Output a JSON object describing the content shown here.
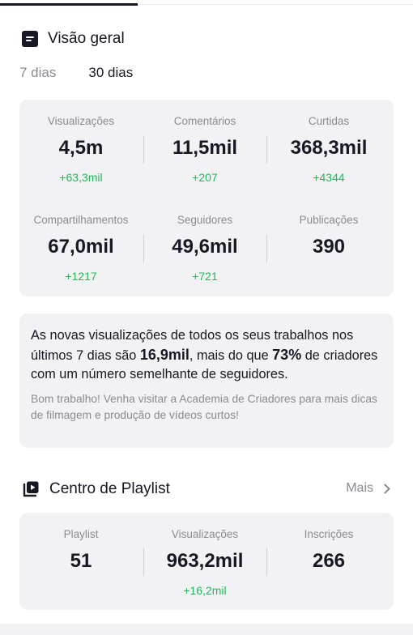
{
  "overview": {
    "title": "Visão geral",
    "icon": "overview-doc-icon",
    "tabs": [
      {
        "label": "7 dias",
        "active": false
      },
      {
        "label": "30 dias",
        "active": true
      }
    ],
    "metrics": [
      {
        "label": "Visualizações",
        "value": "4,5m",
        "delta": "+63,3mil"
      },
      {
        "label": "Comentários",
        "value": "11,5mil",
        "delta": "+207"
      },
      {
        "label": "Curtidas",
        "value": "368,3mil",
        "delta": "+4344"
      },
      {
        "label": "Compartilhamentos",
        "value": "67,0mil",
        "delta": "+1217"
      },
      {
        "label": "Seguidores",
        "value": "49,6mil",
        "delta": "+721"
      },
      {
        "label": "Publicações",
        "value": "390",
        "delta": ""
      }
    ]
  },
  "insight": {
    "text_part1": "As novas visualizações de todos os seus trabalhos nos últimos 7 dias são ",
    "highlight_views": "16,9mil",
    "text_part2": ", mais do que ",
    "highlight_percent": "73%",
    "text_part3": " de criadores com um número semelhante de seguidores.",
    "tip": "Bom trabalho! Venha visitar a Academia de Criadores para mais dicas de filmagem e produção de vídeos curtos!"
  },
  "playlist": {
    "title": "Centro de Playlist",
    "icon": "playlist-play-icon",
    "more_label": "Mais",
    "metrics": [
      {
        "label": "Playlist",
        "value": "51",
        "delta": ""
      },
      {
        "label": "Visualizações",
        "value": "963,2mil",
        "delta": "+16,2mil"
      },
      {
        "label": "Inscrições",
        "value": "266",
        "delta": ""
      }
    ]
  },
  "colors": {
    "positive": "#20b858",
    "card_bg": "#f2f2f4",
    "muted": "#8a8b91",
    "text": "#161823"
  }
}
